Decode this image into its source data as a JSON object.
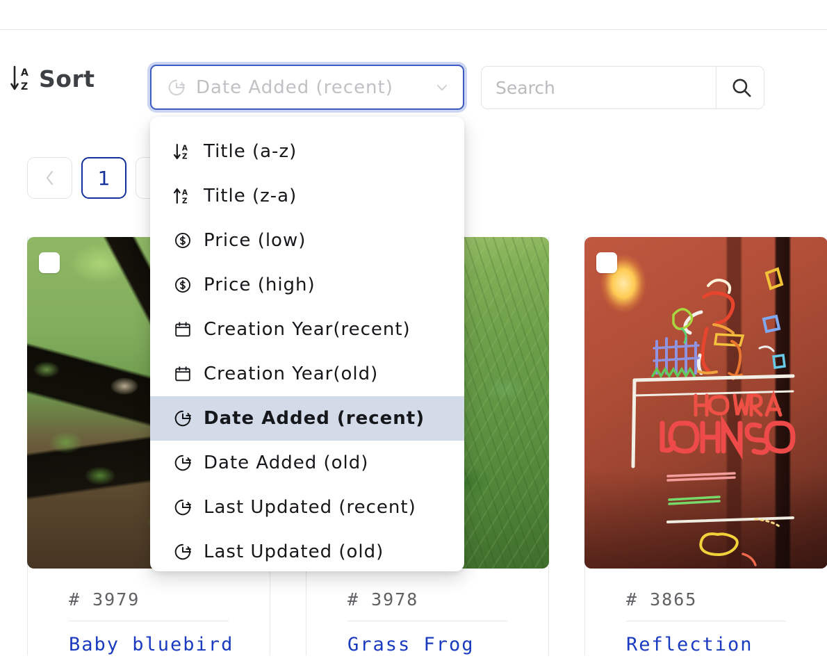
{
  "toolbar": {
    "sort_label": "Sort",
    "sort_icon": "sort-alpha-down-icon",
    "select": {
      "value": "Date Added (recent)",
      "icon": "clock-history-icon",
      "chevron": "chevron-down-icon"
    },
    "search": {
      "value": "",
      "placeholder": "Search",
      "button_icon": "search-icon"
    }
  },
  "sort_menu": {
    "selected": "Date Added (recent)",
    "options": [
      {
        "label": "Title (a-z)",
        "icon": "sort-alpha-down-icon",
        "selected": false
      },
      {
        "label": "Title (z-a)",
        "icon": "sort-alpha-up-icon",
        "selected": false
      },
      {
        "label": "Price (low)",
        "icon": "dollar-circle-icon",
        "selected": false
      },
      {
        "label": "Price (high)",
        "icon": "dollar-circle-icon",
        "selected": false
      },
      {
        "label": "Creation Year(recent)",
        "icon": "calendar-icon",
        "selected": false
      },
      {
        "label": "Creation Year(old)",
        "icon": "calendar-icon",
        "selected": false
      },
      {
        "label": "Date Added (recent)",
        "icon": "clock-history-icon",
        "selected": true
      },
      {
        "label": "Date Added (old)",
        "icon": "clock-history-icon",
        "selected": false
      },
      {
        "label": "Last Updated (recent)",
        "icon": "clock-history-icon",
        "selected": false
      },
      {
        "label": "Last Updated (old)",
        "icon": "clock-history-icon",
        "selected": false
      }
    ]
  },
  "pagination": {
    "prev_label": "‹",
    "pages": [
      {
        "label": "1",
        "active": true
      },
      {
        "label": "",
        "active": false
      }
    ]
  },
  "gallery": {
    "cards": [
      {
        "id": "# 3979",
        "title": "Baby bluebird",
        "checkbox": "select-checkbox",
        "image_alt": "baby-bluebird-photo"
      },
      {
        "id": "# 3978",
        "title": "Grass Frog",
        "checkbox": "select-checkbox",
        "image_alt": "grass-frog-photo"
      },
      {
        "id": "# 3865",
        "title": "Reflection",
        "checkbox": "select-checkbox",
        "image_alt": "neon-sign-reflection-photo"
      }
    ]
  },
  "colors": {
    "accent_blue": "#14309c",
    "focus_border": "#3b5bc0",
    "focus_glow": "#ccd5f1",
    "menu_highlight": "#d3dae8",
    "link_blue": "#1a3bbf",
    "border_gray": "#e6e7e9",
    "muted_text": "#bfc1c4"
  }
}
